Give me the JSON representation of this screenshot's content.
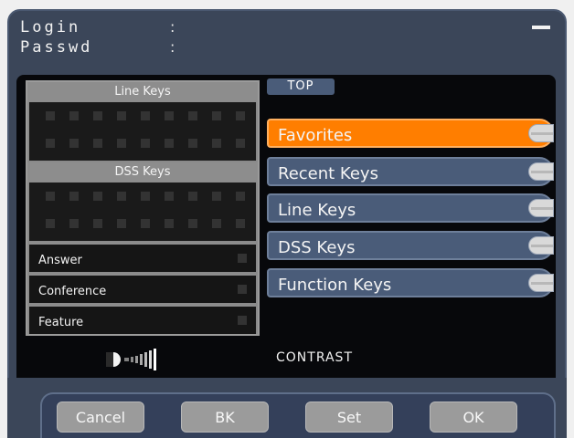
{
  "header": {
    "login_label": "Login",
    "password_label": "Passwd",
    "colon": ":"
  },
  "key_panel": {
    "line_keys_title": "Line Keys",
    "dss_keys_title": "DSS Keys",
    "rows": [
      "Answer",
      "Conference",
      "Feature"
    ]
  },
  "screen": {
    "top_label": "TOP",
    "contrast_label": "CONTRAST",
    "menu": [
      "Favorites",
      "Recent Keys",
      "Line Keys",
      "DSS Keys",
      "Function Keys"
    ],
    "active_index": 0
  },
  "softkeys": [
    "Cancel",
    "BK",
    "Set",
    "OK"
  ],
  "colors": {
    "accent": "#ff7e00",
    "menu_bg": "#4a5c79",
    "screen_bg": "#07080b",
    "frame_bg": "#3b4659"
  }
}
